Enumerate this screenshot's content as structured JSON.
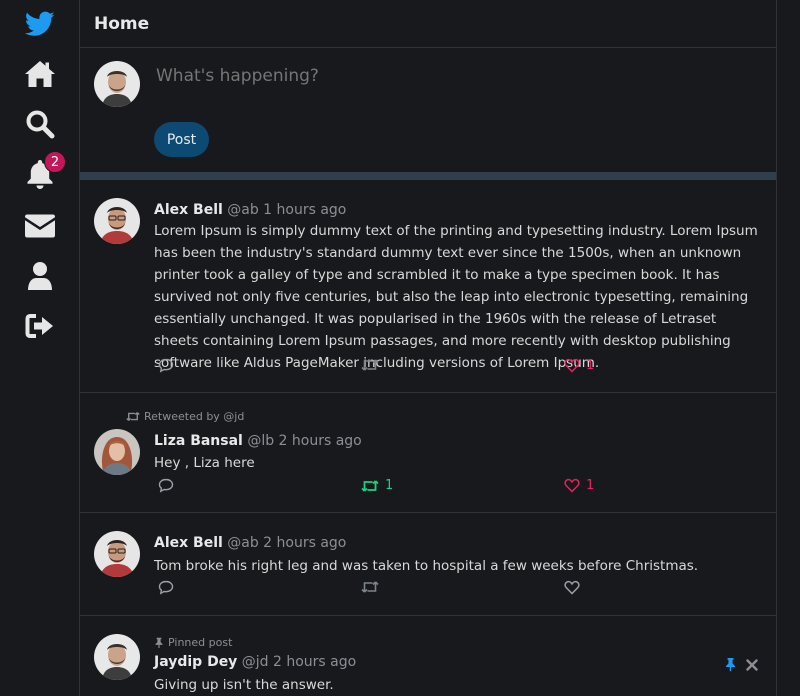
{
  "sidebar": {
    "notification_count": "2"
  },
  "header": {
    "title": "Home"
  },
  "composer": {
    "placeholder": "What's happening?",
    "post_label": "Post"
  },
  "tweets": [
    {
      "context": "",
      "name": "Alex Bell",
      "meta": "@ab 1 hours ago",
      "text": "Lorem Ipsum is simply dummy text of the printing and typesetting industry. Lorem Ipsum has been the industry's standard dummy text ever since the 1500s, when an unknown printer took a galley of type and scrambled it to make a type specimen book. It has survived not only five centuries, but also the leap into electronic typesetting, remaining essentially unchanged. It was popularised in the 1960s with the release of Letraset sheets containing Lorem Ipsum passages, and more recently with desktop publishing software like Aldus PageMaker including versions of Lorem Ipsum.",
      "retweets": "",
      "likes": "1"
    },
    {
      "context": "Retweeted by @jd",
      "name": "Liza Bansal",
      "meta": "@lb 2 hours ago",
      "text": "Hey , Liza here",
      "retweets": "1",
      "likes": "1"
    },
    {
      "context": "",
      "name": "Alex Bell",
      "meta": "@ab 2 hours ago",
      "text": "Tom broke his right leg and was taken to hospital a few weeks before Christmas.",
      "retweets": "",
      "likes": ""
    },
    {
      "context": "Pinned post",
      "name": "Jaydip Dey",
      "meta": "@jd 2 hours ago",
      "text": "Giving up isn't the answer.",
      "retweets": "",
      "likes": ""
    }
  ],
  "colors": {
    "brand": "#1d9bf0",
    "like_active": "#e0245e",
    "retweet_active": "#1fcf7d",
    "post_button": "#0d4a73",
    "badge": "#c2185b"
  }
}
